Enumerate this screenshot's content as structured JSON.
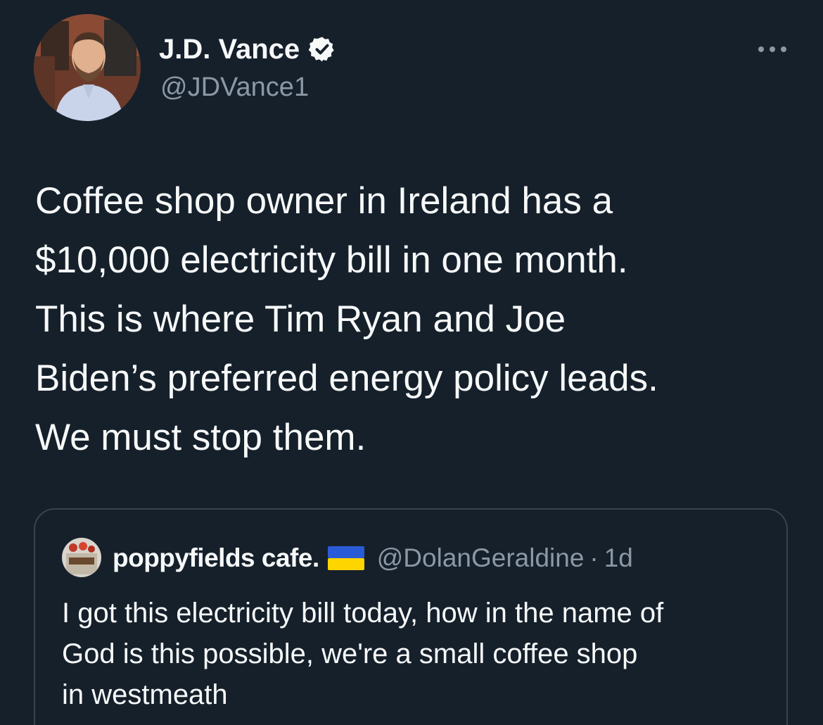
{
  "tweet": {
    "display_name": "J.D. Vance",
    "handle": "@JDVance1",
    "text": "Coffee shop owner in Ireland has a\n$10,000 electricity bill in one month.\nThis is where Tim Ryan and Joe\nBiden’s preferred energy policy leads.\nWe must stop them."
  },
  "quote": {
    "display_name": "poppyfields cafe.",
    "handle": "@DolanGeraldine",
    "separator": "·",
    "time": "1d",
    "text": "I got this electricity bill today, how in the name of\nGod  is this possible,  we're a small coffee shop\nin westmeath"
  },
  "icons": {
    "verified": "verified-badge-icon",
    "more": "more-options-icon",
    "flag": "ukraine-flag-icon"
  },
  "colors": {
    "background": "#15202b",
    "text_primary": "#f7f9f9",
    "text_secondary": "#8b98a5",
    "border": "#38444d",
    "flag_blue": "#2a5bd7",
    "flag_yellow": "#ffd500"
  }
}
